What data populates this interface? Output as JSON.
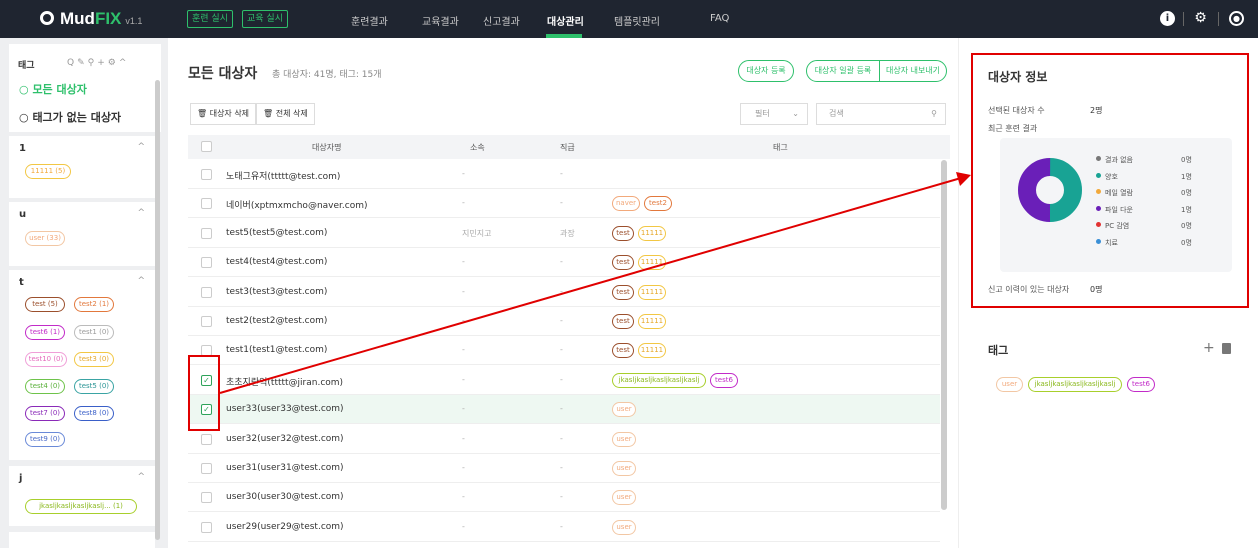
{
  "header": {
    "logo_main": "Mud",
    "logo_fix": "FIX",
    "logo_version": "v1.1",
    "btn_training": "훈련 실시",
    "btn_education": "교육 실시",
    "nav": [
      "훈련결과",
      "교육결과",
      "신고결과",
      "대상관리",
      "템플릿관리",
      "FAQ"
    ],
    "active_nav": "대상관리"
  },
  "sidebar": {
    "title": "태그",
    "all_targets": "모든 대상자",
    "untagged": "태그가 없는 대상자",
    "groups": [
      {
        "title": "1",
        "tags": [
          {
            "label": "11111 (5)"
          }
        ]
      },
      {
        "title": "u",
        "tags": [
          {
            "label": "user (33)"
          }
        ]
      },
      {
        "title": "t",
        "tags": [
          {
            "label": "test (5)"
          },
          {
            "label": "test2 (1)"
          },
          {
            "label": "test6 (1)"
          },
          {
            "label": "test1 (0)"
          },
          {
            "label": "test10 (0)"
          },
          {
            "label": "test3 (0)"
          },
          {
            "label": "test4 (0)"
          },
          {
            "label": "test5 (0)"
          },
          {
            "label": "test7 (0)"
          },
          {
            "label": "test8 (0)"
          },
          {
            "label": "test9 (0)"
          }
        ]
      },
      {
        "title": "j",
        "tags": [
          {
            "label": "jkasljkasljkasljkaslj... (1)"
          }
        ]
      }
    ]
  },
  "main": {
    "title": "모든 대상자",
    "subtitle": "총 대상자: 41명, 태그: 15개",
    "btn_register": "대상자 등록",
    "btn_bulk": "대상자 일괄 등록",
    "btn_export": "대상자 내보내기",
    "btn_delete_target": "대상자 삭제",
    "btn_delete_all": "전체 삭제",
    "filter_placeholder": "필터",
    "search_placeholder": "검색",
    "columns": [
      "대상자명",
      "소속",
      "직급",
      "태그"
    ],
    "rows": [
      {
        "name": "노태그유저(ttttt@test.com)",
        "dept": "-",
        "pos": "-",
        "tags": [],
        "checked": false
      },
      {
        "name": "네이버(xptmxmcho@naver.com)",
        "dept": "-",
        "pos": "-",
        "tags": [
          "naver",
          "test2"
        ],
        "checked": false
      },
      {
        "name": "test5(test5@test.com)",
        "dept": "지민지고",
        "pos": "과장",
        "tags": [
          "test",
          "11111"
        ],
        "checked": false
      },
      {
        "name": "test4(test4@test.com)",
        "dept": "-",
        "pos": "-",
        "tags": [
          "test",
          "11111"
        ],
        "checked": false
      },
      {
        "name": "test3(test3@test.com)",
        "dept": "-",
        "pos": "-",
        "tags": [
          "test",
          "11111"
        ],
        "checked": false
      },
      {
        "name": "test2(test2@test.com)",
        "dept": "-",
        "pos": "-",
        "tags": [
          "test",
          "11111"
        ],
        "checked": false
      },
      {
        "name": "test1(test1@test.com)",
        "dept": "-",
        "pos": "-",
        "tags": [
          "test",
          "11111"
        ],
        "checked": false
      },
      {
        "name": "초초지란익(ttttt@jiran.com)",
        "dept": "-",
        "pos": "-",
        "tags": [
          "jkasljkasljkasljkasljkaslj",
          "test6"
        ],
        "checked": true
      },
      {
        "name": "user33(user33@test.com)",
        "dept": "-",
        "pos": "-",
        "tags": [
          "user"
        ],
        "checked": true
      },
      {
        "name": "user32(user32@test.com)",
        "dept": "-",
        "pos": "-",
        "tags": [
          "user"
        ],
        "checked": false
      },
      {
        "name": "user31(user31@test.com)",
        "dept": "-",
        "pos": "-",
        "tags": [
          "user"
        ],
        "checked": false
      },
      {
        "name": "user30(user30@test.com)",
        "dept": "-",
        "pos": "-",
        "tags": [
          "user"
        ],
        "checked": false
      },
      {
        "name": "user29(user29@test.com)",
        "dept": "-",
        "pos": "-",
        "tags": [
          "user"
        ],
        "checked": false
      }
    ]
  },
  "info": {
    "title": "대상자 정보",
    "selected_label": "선택된 대상자 수",
    "selected_value": "2명",
    "recent_label": "최근 훈련 결과",
    "legend": [
      {
        "label": "결과 없음",
        "value": "0명",
        "color": "#777777"
      },
      {
        "label": "양호",
        "value": "1명",
        "color": "#18a394"
      },
      {
        "label": "메일 열람",
        "value": "0명",
        "color": "#f2a93b"
      },
      {
        "label": "파일 다운",
        "value": "1명",
        "color": "#6a1fb8"
      },
      {
        "label": "PC 감염",
        "value": "0명",
        "color": "#e23232"
      },
      {
        "label": "치료",
        "value": "0명",
        "color": "#3a8fd6"
      }
    ],
    "report_label": "신고 이력이 있는 대상자",
    "report_value": "0명",
    "tag_title": "태그",
    "tags": [
      "user",
      "jkasljkasljkasljkasljkaslj",
      "test6"
    ]
  },
  "colors": {
    "brand": "#2ec06b",
    "topbar": "#1f2530",
    "annotation": "#e00000"
  }
}
